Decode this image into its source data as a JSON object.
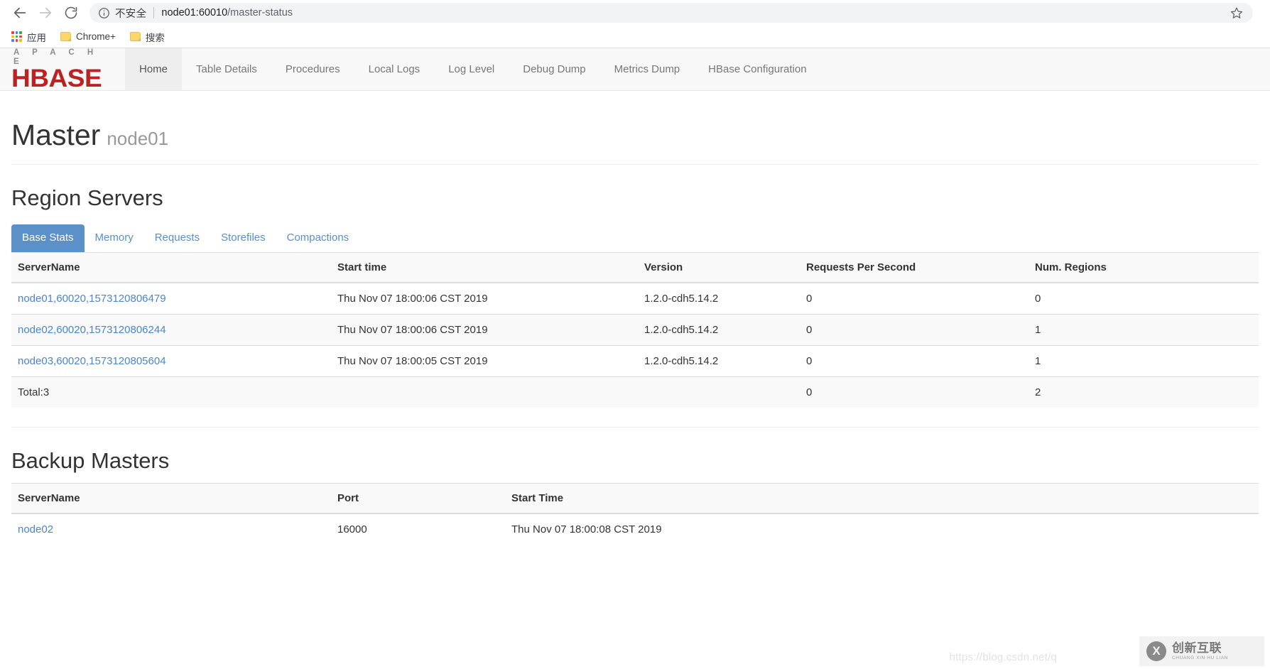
{
  "browser": {
    "back_icon": "back-arrow-icon",
    "forward_icon": "forward-arrow-icon",
    "reload_icon": "reload-icon",
    "info_icon": "info-circle-icon",
    "security_label": "不安全",
    "url_host": "node01:60010",
    "url_path": "/master-status",
    "url_full": "node01:60010/master-status",
    "star_icon": "bookmark-star-icon",
    "bookmarks": [
      {
        "label": "应用",
        "icon": "apps-grid-icon"
      },
      {
        "label": "Chrome+",
        "icon": "folder-icon"
      },
      {
        "label": "搜索",
        "icon": "folder-icon"
      }
    ]
  },
  "navbar": {
    "brand_top": "A P A C H E",
    "brand_main": "HBASE",
    "links": [
      {
        "label": "Home",
        "active": true
      },
      {
        "label": "Table Details",
        "active": false
      },
      {
        "label": "Procedures",
        "active": false
      },
      {
        "label": "Local Logs",
        "active": false
      },
      {
        "label": "Log Level",
        "active": false
      },
      {
        "label": "Debug Dump",
        "active": false
      },
      {
        "label": "Metrics Dump",
        "active": false
      },
      {
        "label": "HBase Configuration",
        "active": false
      }
    ]
  },
  "header": {
    "title": "Master",
    "subtitle": "node01"
  },
  "region_servers": {
    "heading": "Region Servers",
    "tabs": [
      {
        "label": "Base Stats",
        "active": true
      },
      {
        "label": "Memory",
        "active": false
      },
      {
        "label": "Requests",
        "active": false
      },
      {
        "label": "Storefiles",
        "active": false
      },
      {
        "label": "Compactions",
        "active": false
      }
    ],
    "columns": [
      "ServerName",
      "Start time",
      "Version",
      "Requests Per Second",
      "Num. Regions"
    ],
    "rows": [
      {
        "server_name": "node01,60020,1573120806479",
        "start_time": "Thu Nov 07 18:00:06 CST 2019",
        "version": "1.2.0-cdh5.14.2",
        "requests_per_second": "0",
        "num_regions": "0"
      },
      {
        "server_name": "node02,60020,1573120806244",
        "start_time": "Thu Nov 07 18:00:06 CST 2019",
        "version": "1.2.0-cdh5.14.2",
        "requests_per_second": "0",
        "num_regions": "1"
      },
      {
        "server_name": "node03,60020,1573120805604",
        "start_time": "Thu Nov 07 18:00:05 CST 2019",
        "version": "1.2.0-cdh5.14.2",
        "requests_per_second": "0",
        "num_regions": "1"
      }
    ],
    "total": {
      "label": "Total:3",
      "start_time": "",
      "version": "",
      "requests_per_second": "0",
      "num_regions": "2"
    }
  },
  "backup_masters": {
    "heading": "Backup Masters",
    "columns": [
      "ServerName",
      "Port",
      "Start Time"
    ],
    "rows": [
      {
        "server_name": "node02",
        "port": "16000",
        "start_time": "Thu Nov 07 18:00:08 CST 2019"
      }
    ]
  },
  "watermark": {
    "url": "https://blog.csdn.net/q",
    "logo_mark": "X",
    "logo_cn": "创新互联",
    "logo_py": "CHUANG XIN HU LIAN"
  },
  "colors": {
    "brand_red": "#bb2222",
    "tab_active_blue": "#5b90c8",
    "link_blue": "#4a86c8",
    "nav_bg": "#f8f8f8"
  }
}
